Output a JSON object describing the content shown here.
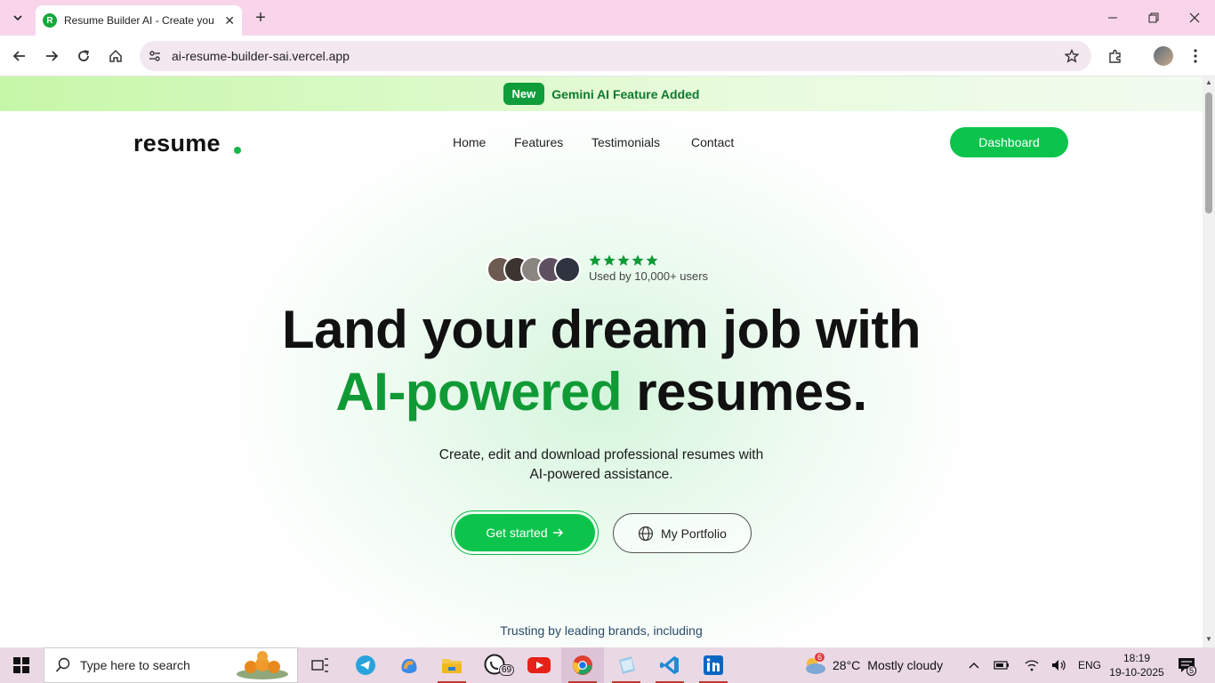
{
  "browser": {
    "tab_title": "Resume Builder AI - Create you",
    "favicon_letter": "R",
    "url": "ai-resume-builder-sai.vercel.app"
  },
  "announcement": {
    "badge": "New",
    "text": "Gemini AI Feature Added"
  },
  "site": {
    "logo": "resume",
    "nav": [
      "Home",
      "Features",
      "Testimonials",
      "Contact"
    ],
    "dashboard_button": "Dashboard"
  },
  "hero": {
    "rating_stars": 5,
    "users_text": "Used by 10,000+ users",
    "headline_line1": "Land your dream job with",
    "headline_highlight": "AI-powered",
    "headline_rest": "resumes.",
    "subtitle_line1": "Create, edit and download professional resumes with",
    "subtitle_line2": "AI-powered assistance.",
    "primary_button": "Get started",
    "secondary_button": "My Portfolio",
    "trust_text": "Trusting by leading brands, including"
  },
  "taskbar": {
    "search_placeholder": "Type here to search",
    "whatsapp_badge": "69",
    "weather_badge": "6",
    "weather_temp": "28°C",
    "weather_desc": "Mostly cloudy",
    "language": "ENG",
    "time": "18:19",
    "date": "19-10-2025",
    "notification_count": "5"
  },
  "colors": {
    "accent_green": "#0cc44c",
    "headline_green": "#109a36",
    "tabstrip_pink": "#f8d5ea"
  }
}
